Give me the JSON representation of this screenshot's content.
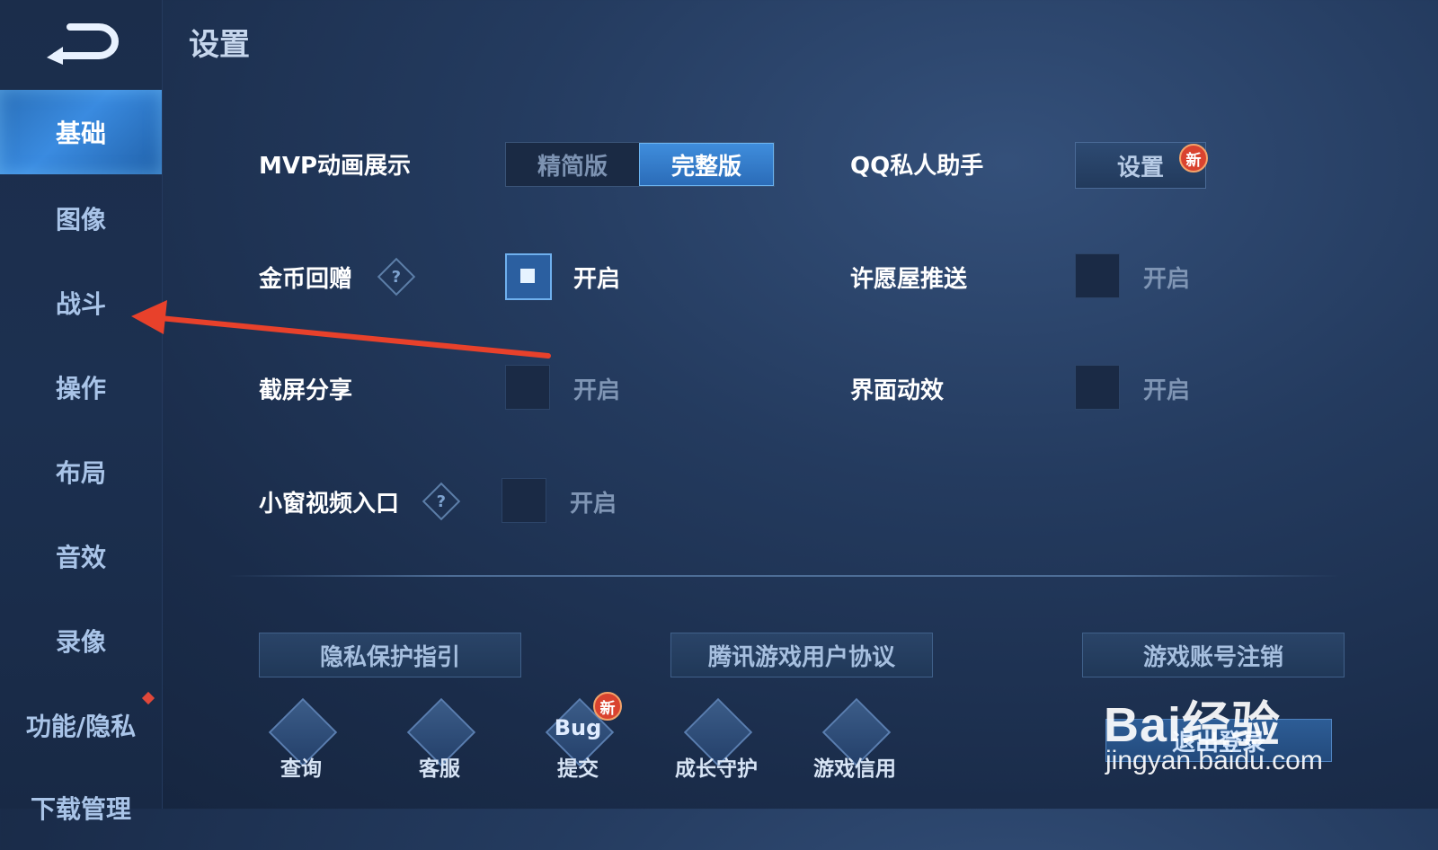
{
  "page": {
    "title": "设置"
  },
  "sidebar": {
    "items": [
      {
        "label": "基础"
      },
      {
        "label": "图像"
      },
      {
        "label": "战斗"
      },
      {
        "label": "操作"
      },
      {
        "label": "布局"
      },
      {
        "label": "音效"
      },
      {
        "label": "录像"
      },
      {
        "label": "功能/隐私"
      },
      {
        "label": "下载管理"
      }
    ]
  },
  "settings": {
    "mvp": {
      "label": "MVP动画展示",
      "options": [
        "精简版",
        "完整版"
      ],
      "selected": "完整版"
    },
    "qq": {
      "label": "QQ私人助手",
      "button": "设置",
      "badge": "新"
    },
    "coin": {
      "label": "金币回赠",
      "help": "?",
      "option": "开启",
      "checked": true
    },
    "wish": {
      "label": "许愿屋推送",
      "option": "开启",
      "checked": false
    },
    "screenshot": {
      "label": "截屏分享",
      "option": "开启",
      "checked": false
    },
    "ui_effect": {
      "label": "界面动效",
      "option": "开启",
      "checked": false
    },
    "mini_video": {
      "label": "小窗视频入口",
      "help": "?",
      "option": "开启",
      "checked": false
    }
  },
  "links": {
    "privacy": "隐私保护指引",
    "agreement": "腾讯游戏用户协议",
    "cancel_account": "游戏账号注销"
  },
  "tools": [
    {
      "label": "查询",
      "icon": "search-doc-icon",
      "glyph": ""
    },
    {
      "label": "客服",
      "icon": "cat-service-icon",
      "glyph": ""
    },
    {
      "label": "提交",
      "icon": "bug-icon",
      "glyph": "Bug",
      "badge": "新"
    },
    {
      "label": "成长守护",
      "icon": "guard-ring-icon",
      "glyph": ""
    },
    {
      "label": "游戏信用",
      "icon": "shield-icon",
      "glyph": ""
    }
  ],
  "logout": {
    "label": "退出登录"
  },
  "watermark": {
    "brand": "Bai经验",
    "url": "jingyan.baidu.com"
  },
  "colors": {
    "accent": "#3a8be0",
    "badge": "#d9432f",
    "annotation_arrow": "#e8412b"
  }
}
